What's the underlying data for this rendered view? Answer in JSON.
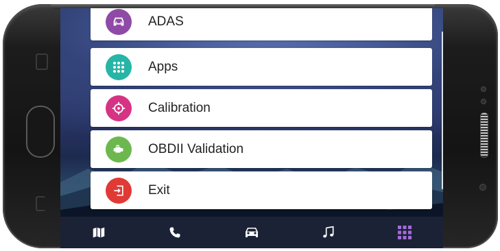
{
  "menu": {
    "items": [
      {
        "label": "ADAS",
        "icon": "car-icon",
        "color": "#8e4aa6"
      },
      {
        "label": "Apps",
        "icon": "grid-icon",
        "color": "#27b5a6"
      },
      {
        "label": "Calibration",
        "icon": "crosshair-icon",
        "color": "#d63384"
      },
      {
        "label": "OBDII Validation",
        "icon": "engine-icon",
        "color": "#6cb84f"
      },
      {
        "label": "Exit",
        "icon": "exit-icon",
        "color": "#e03a36"
      }
    ]
  },
  "bottom_nav": {
    "items": [
      {
        "icon": "map-icon",
        "active": false
      },
      {
        "icon": "phone-icon",
        "active": false
      },
      {
        "icon": "car-icon",
        "active": false
      },
      {
        "icon": "music-icon",
        "active": false
      },
      {
        "icon": "apps-grid-icon",
        "active": true
      }
    ],
    "active_color": "#a46bd8",
    "icon_color": "#ffffff",
    "background": "#1b2235"
  }
}
